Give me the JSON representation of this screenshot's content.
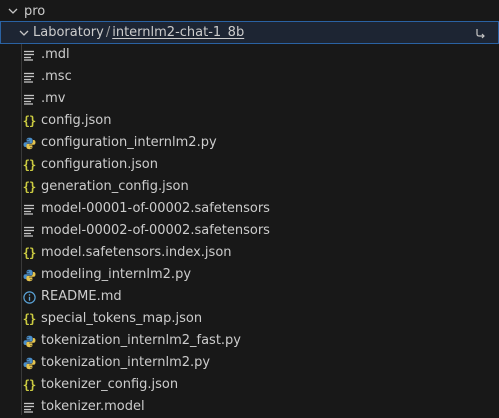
{
  "explorer": {
    "root": {
      "label": "pro"
    },
    "folder": {
      "parent": "Laboratory",
      "separator": "/",
      "child": "internlm2-chat-1_8b"
    },
    "files": [
      {
        "name": ".mdl",
        "icon": "lines-icon"
      },
      {
        "name": ".msc",
        "icon": "lines-icon"
      },
      {
        "name": ".mv",
        "icon": "lines-icon"
      },
      {
        "name": "config.json",
        "icon": "json-icon"
      },
      {
        "name": "configuration_internlm2.py",
        "icon": "python-icon"
      },
      {
        "name": "configuration.json",
        "icon": "json-icon"
      },
      {
        "name": "generation_config.json",
        "icon": "json-icon"
      },
      {
        "name": "model-00001-of-00002.safetensors",
        "icon": "lines-icon"
      },
      {
        "name": "model-00002-of-00002.safetensors",
        "icon": "lines-icon"
      },
      {
        "name": "model.safetensors.index.json",
        "icon": "json-icon"
      },
      {
        "name": "modeling_internlm2.py",
        "icon": "python-icon"
      },
      {
        "name": "README.md",
        "icon": "info-icon"
      },
      {
        "name": "special_tokens_map.json",
        "icon": "json-icon"
      },
      {
        "name": "tokenization_internlm2_fast.py",
        "icon": "python-icon"
      },
      {
        "name": "tokenization_internlm2.py",
        "icon": "python-icon"
      },
      {
        "name": "tokenizer_config.json",
        "icon": "json-icon"
      },
      {
        "name": "tokenizer.model",
        "icon": "lines-icon"
      }
    ]
  },
  "colors": {
    "json": "#cbcb41",
    "python_blue": "#4a8ec9",
    "python_yellow": "#e5c44f",
    "info": "#5aa2d6",
    "selection_border": "#2a62a3"
  }
}
